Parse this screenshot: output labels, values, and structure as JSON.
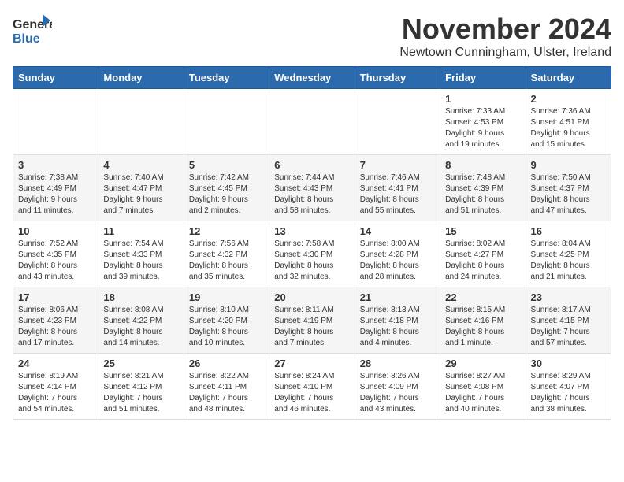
{
  "logo": {
    "general": "General",
    "blue": "Blue"
  },
  "title": "November 2024",
  "location": "Newtown Cunningham, Ulster, Ireland",
  "days_of_week": [
    "Sunday",
    "Monday",
    "Tuesday",
    "Wednesday",
    "Thursday",
    "Friday",
    "Saturday"
  ],
  "weeks": [
    [
      {
        "day": "",
        "info": ""
      },
      {
        "day": "",
        "info": ""
      },
      {
        "day": "",
        "info": ""
      },
      {
        "day": "",
        "info": ""
      },
      {
        "day": "",
        "info": ""
      },
      {
        "day": "1",
        "info": "Sunrise: 7:33 AM\nSunset: 4:53 PM\nDaylight: 9 hours\nand 19 minutes."
      },
      {
        "day": "2",
        "info": "Sunrise: 7:36 AM\nSunset: 4:51 PM\nDaylight: 9 hours\nand 15 minutes."
      }
    ],
    [
      {
        "day": "3",
        "info": "Sunrise: 7:38 AM\nSunset: 4:49 PM\nDaylight: 9 hours\nand 11 minutes."
      },
      {
        "day": "4",
        "info": "Sunrise: 7:40 AM\nSunset: 4:47 PM\nDaylight: 9 hours\nand 7 minutes."
      },
      {
        "day": "5",
        "info": "Sunrise: 7:42 AM\nSunset: 4:45 PM\nDaylight: 9 hours\nand 2 minutes."
      },
      {
        "day": "6",
        "info": "Sunrise: 7:44 AM\nSunset: 4:43 PM\nDaylight: 8 hours\nand 58 minutes."
      },
      {
        "day": "7",
        "info": "Sunrise: 7:46 AM\nSunset: 4:41 PM\nDaylight: 8 hours\nand 55 minutes."
      },
      {
        "day": "8",
        "info": "Sunrise: 7:48 AM\nSunset: 4:39 PM\nDaylight: 8 hours\nand 51 minutes."
      },
      {
        "day": "9",
        "info": "Sunrise: 7:50 AM\nSunset: 4:37 PM\nDaylight: 8 hours\nand 47 minutes."
      }
    ],
    [
      {
        "day": "10",
        "info": "Sunrise: 7:52 AM\nSunset: 4:35 PM\nDaylight: 8 hours\nand 43 minutes."
      },
      {
        "day": "11",
        "info": "Sunrise: 7:54 AM\nSunset: 4:33 PM\nDaylight: 8 hours\nand 39 minutes."
      },
      {
        "day": "12",
        "info": "Sunrise: 7:56 AM\nSunset: 4:32 PM\nDaylight: 8 hours\nand 35 minutes."
      },
      {
        "day": "13",
        "info": "Sunrise: 7:58 AM\nSunset: 4:30 PM\nDaylight: 8 hours\nand 32 minutes."
      },
      {
        "day": "14",
        "info": "Sunrise: 8:00 AM\nSunset: 4:28 PM\nDaylight: 8 hours\nand 28 minutes."
      },
      {
        "day": "15",
        "info": "Sunrise: 8:02 AM\nSunset: 4:27 PM\nDaylight: 8 hours\nand 24 minutes."
      },
      {
        "day": "16",
        "info": "Sunrise: 8:04 AM\nSunset: 4:25 PM\nDaylight: 8 hours\nand 21 minutes."
      }
    ],
    [
      {
        "day": "17",
        "info": "Sunrise: 8:06 AM\nSunset: 4:23 PM\nDaylight: 8 hours\nand 17 minutes."
      },
      {
        "day": "18",
        "info": "Sunrise: 8:08 AM\nSunset: 4:22 PM\nDaylight: 8 hours\nand 14 minutes."
      },
      {
        "day": "19",
        "info": "Sunrise: 8:10 AM\nSunset: 4:20 PM\nDaylight: 8 hours\nand 10 minutes."
      },
      {
        "day": "20",
        "info": "Sunrise: 8:11 AM\nSunset: 4:19 PM\nDaylight: 8 hours\nand 7 minutes."
      },
      {
        "day": "21",
        "info": "Sunrise: 8:13 AM\nSunset: 4:18 PM\nDaylight: 8 hours\nand 4 minutes."
      },
      {
        "day": "22",
        "info": "Sunrise: 8:15 AM\nSunset: 4:16 PM\nDaylight: 8 hours\nand 1 minute."
      },
      {
        "day": "23",
        "info": "Sunrise: 8:17 AM\nSunset: 4:15 PM\nDaylight: 7 hours\nand 57 minutes."
      }
    ],
    [
      {
        "day": "24",
        "info": "Sunrise: 8:19 AM\nSunset: 4:14 PM\nDaylight: 7 hours\nand 54 minutes."
      },
      {
        "day": "25",
        "info": "Sunrise: 8:21 AM\nSunset: 4:12 PM\nDaylight: 7 hours\nand 51 minutes."
      },
      {
        "day": "26",
        "info": "Sunrise: 8:22 AM\nSunset: 4:11 PM\nDaylight: 7 hours\nand 48 minutes."
      },
      {
        "day": "27",
        "info": "Sunrise: 8:24 AM\nSunset: 4:10 PM\nDaylight: 7 hours\nand 46 minutes."
      },
      {
        "day": "28",
        "info": "Sunrise: 8:26 AM\nSunset: 4:09 PM\nDaylight: 7 hours\nand 43 minutes."
      },
      {
        "day": "29",
        "info": "Sunrise: 8:27 AM\nSunset: 4:08 PM\nDaylight: 7 hours\nand 40 minutes."
      },
      {
        "day": "30",
        "info": "Sunrise: 8:29 AM\nSunset: 4:07 PM\nDaylight: 7 hours\nand 38 minutes."
      }
    ]
  ]
}
